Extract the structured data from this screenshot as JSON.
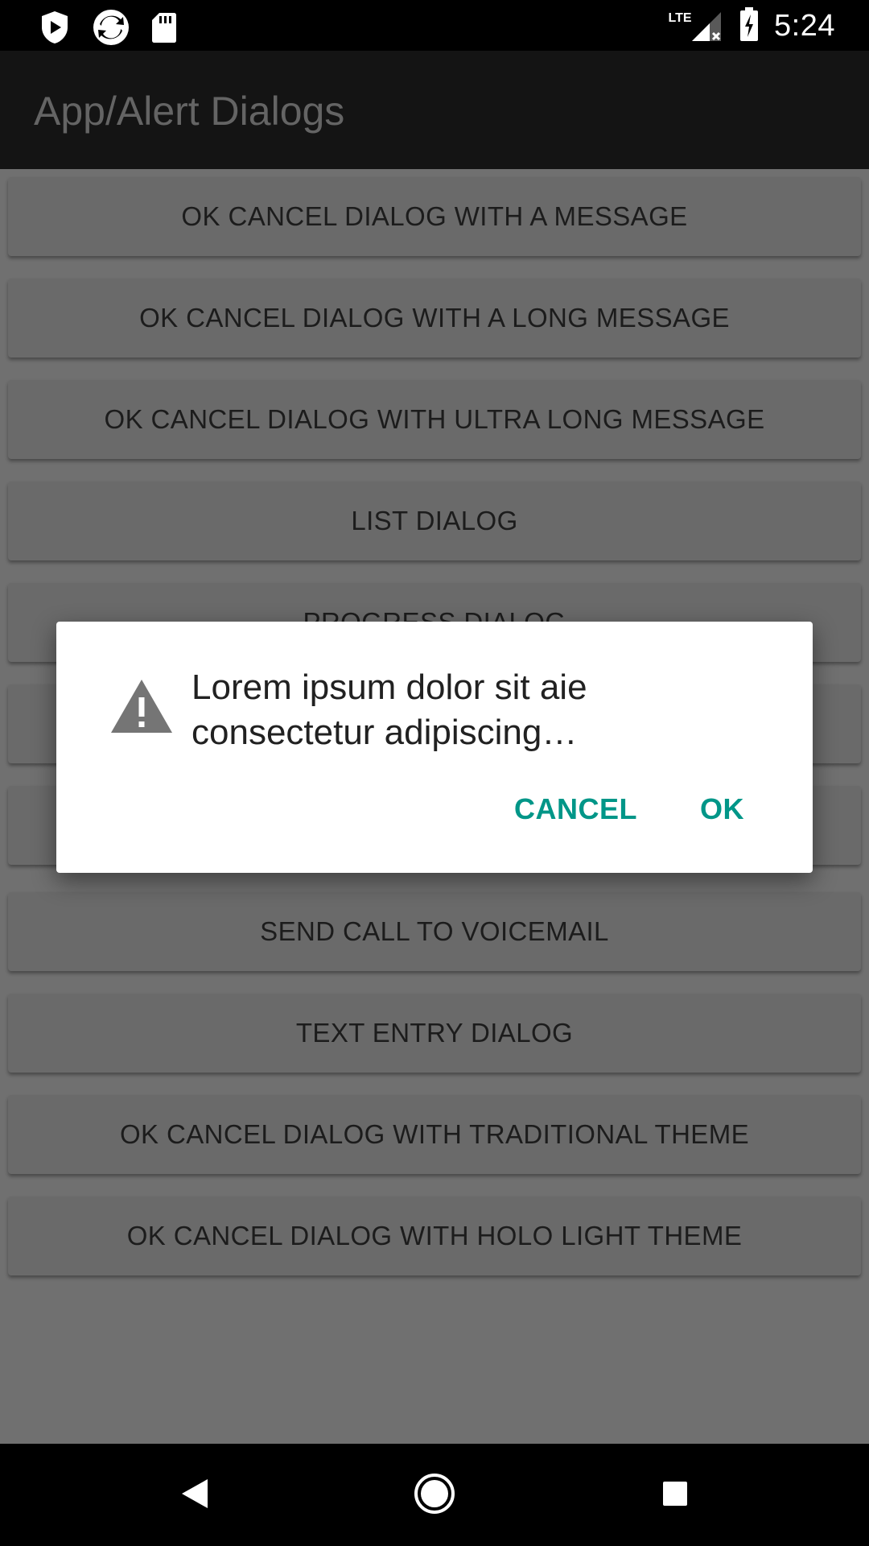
{
  "status_bar": {
    "time": "5:24",
    "network": "LTE",
    "icons": [
      "play-store-icon",
      "sync-icon",
      "sd-card-icon",
      "signal-icon",
      "battery-icon"
    ]
  },
  "app_bar": {
    "title": "App/Alert Dialogs"
  },
  "buttons": [
    {
      "label": "OK CANCEL DIALOG WITH A MESSAGE"
    },
    {
      "label": "OK CANCEL DIALOG WITH A LONG MESSAGE"
    },
    {
      "label": "OK CANCEL DIALOG WITH ULTRA LONG MESSAGE"
    },
    {
      "label": "LIST DIALOG"
    },
    {
      "label": "PROGRESS DIALOG"
    },
    {
      "label": ""
    },
    {
      "label": ""
    },
    {
      "label": "SEND CALL TO VOICEMAIL"
    },
    {
      "label": "TEXT ENTRY DIALOG"
    },
    {
      "label": "OK CANCEL DIALOG WITH TRADITIONAL THEME"
    },
    {
      "label": "OK CANCEL DIALOG WITH HOLO LIGHT THEME"
    }
  ],
  "dialog": {
    "icon": "warning-icon",
    "title": "Lorem ipsum dolor sit aie consectetur adipiscing…",
    "cancel_label": "CANCEL",
    "ok_label": "OK",
    "accent_color": "#009688"
  },
  "nav_bar": {
    "icons": [
      "back-icon",
      "home-icon",
      "recents-icon"
    ]
  }
}
